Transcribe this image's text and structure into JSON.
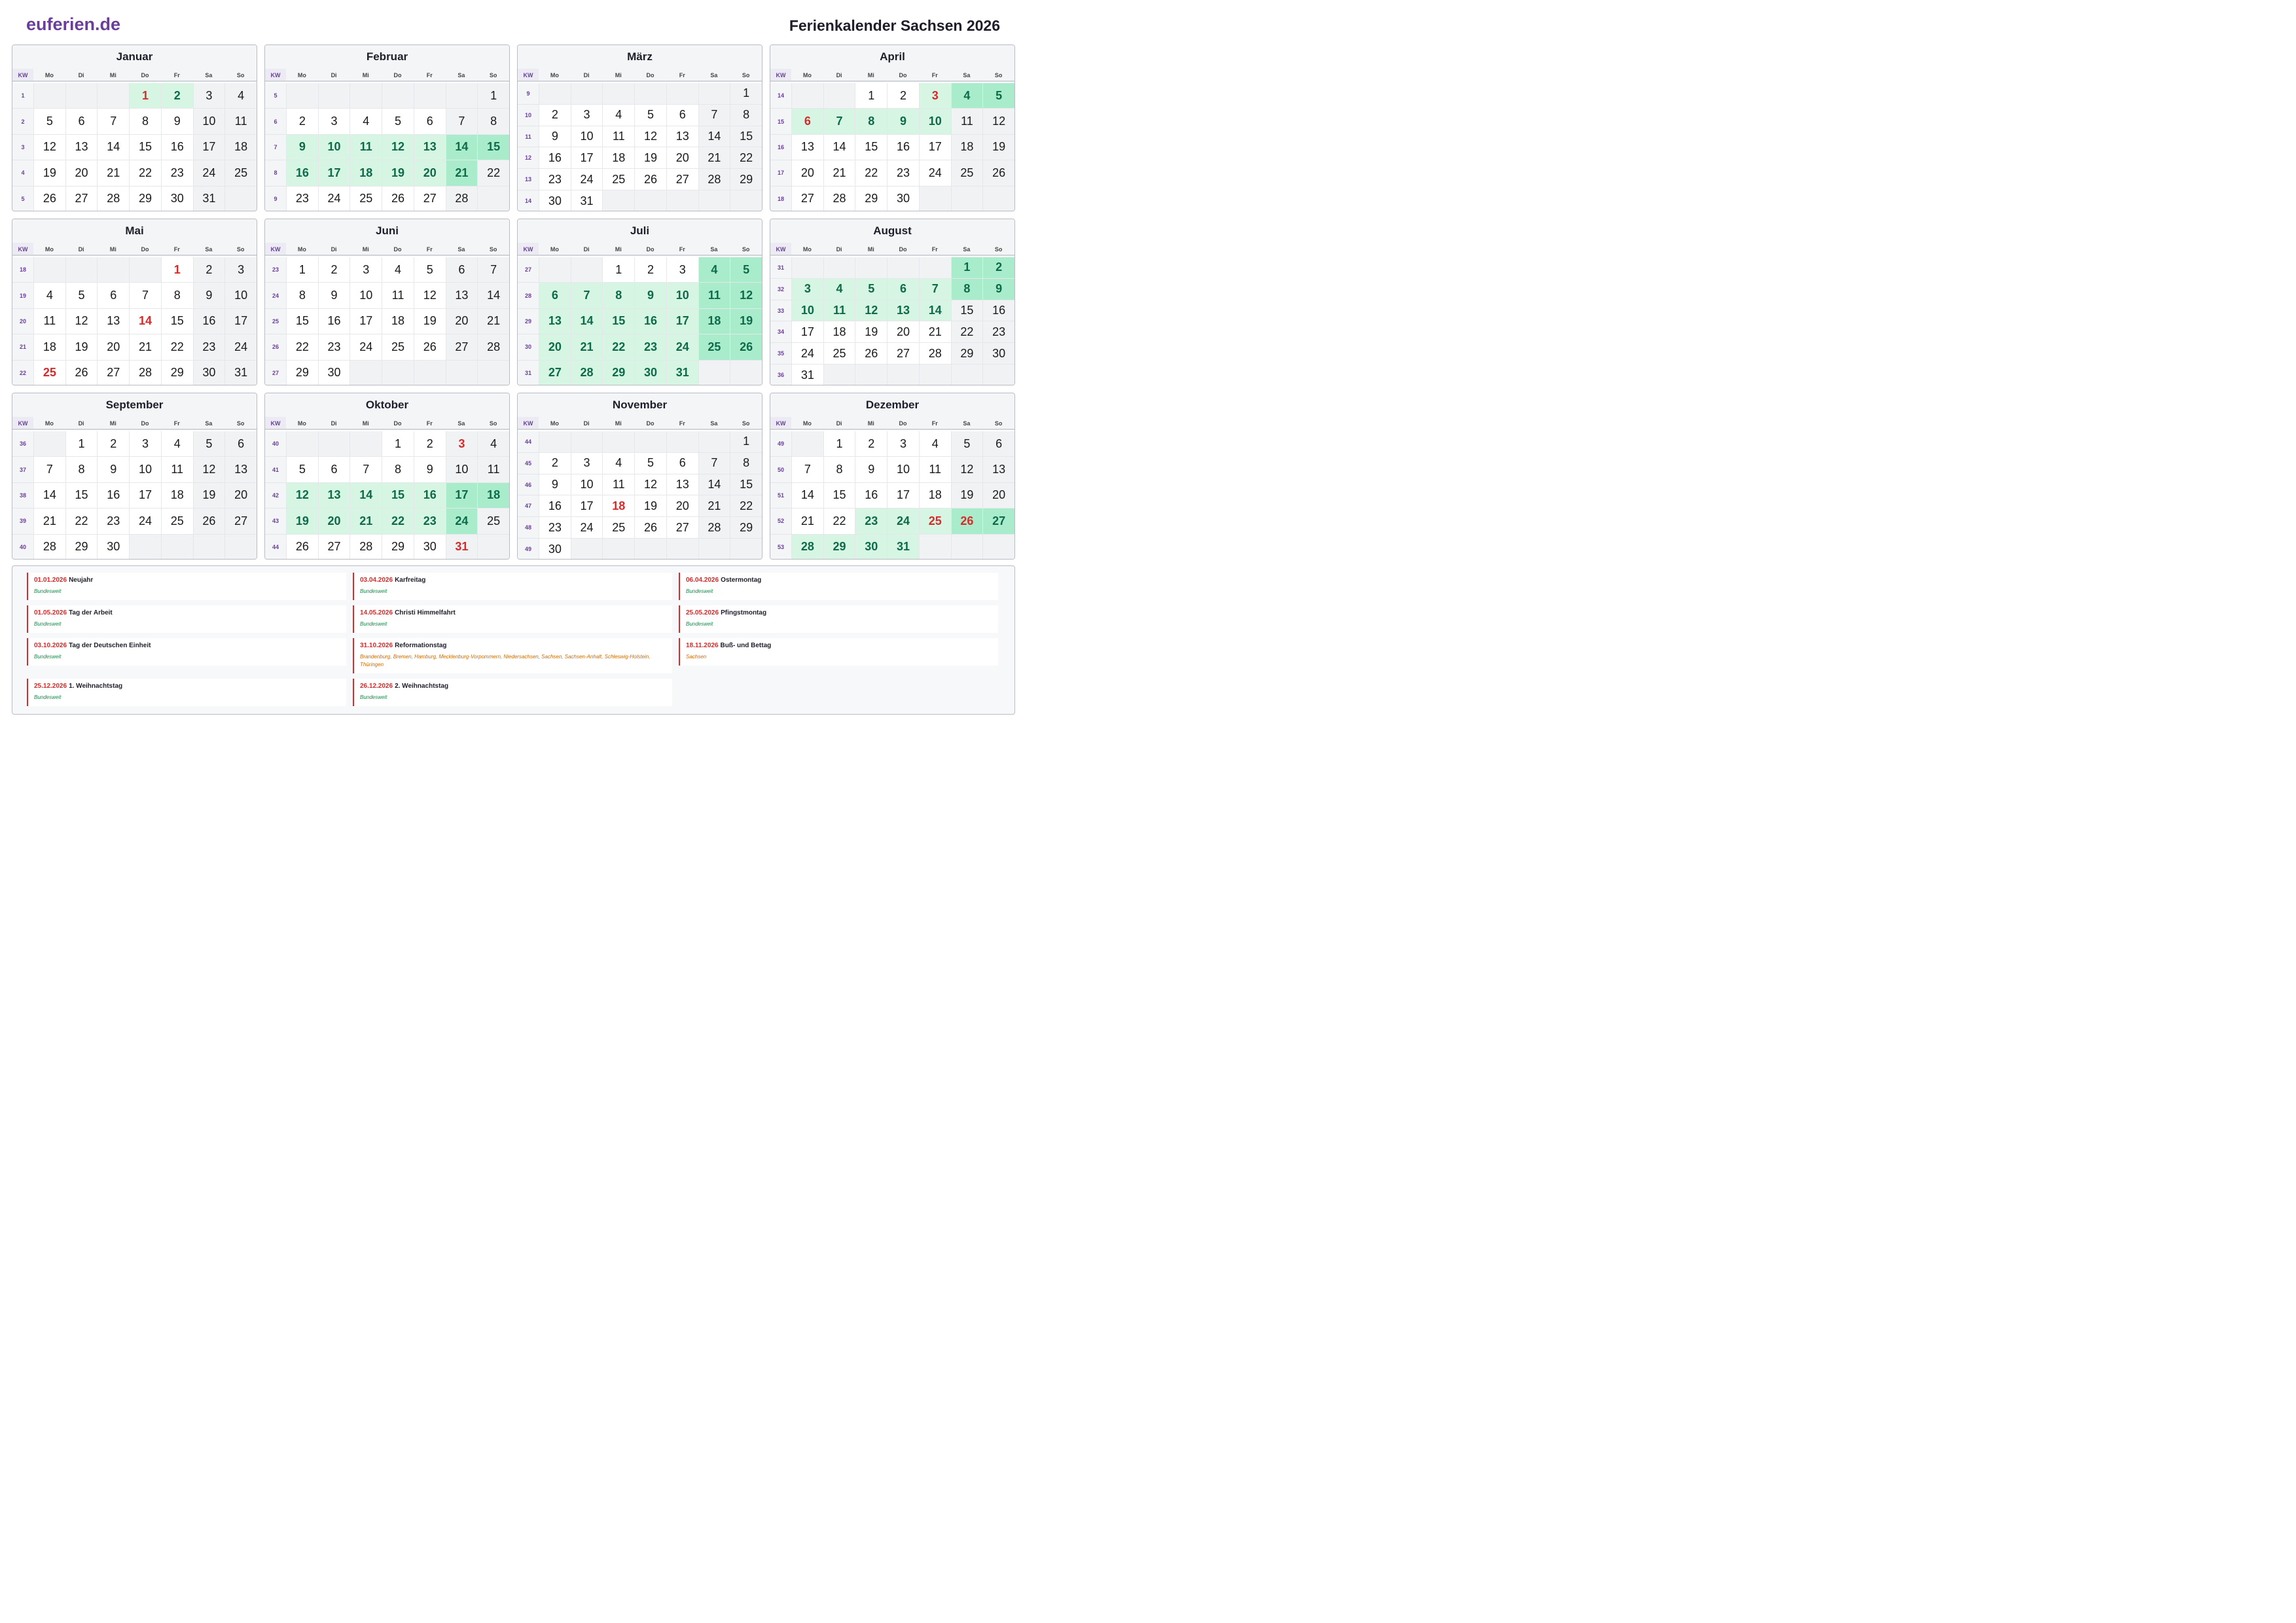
{
  "brand": "euferien.de",
  "title": "Ferienkalender Sachsen 2026",
  "weekday_headers": [
    "Mo",
    "Di",
    "Mi",
    "Do",
    "Fr",
    "Sa",
    "So"
  ],
  "kw_header": "KW",
  "colors": {
    "brand": "#6a3f9a",
    "holiday": "#d52b2b",
    "vacation_bg": "#d6f5e3",
    "vacation_weekend_bg": "#a9eccb",
    "vacation_text": "#0d6b4a",
    "weekend_bg": "#f1f2f4"
  },
  "months": [
    {
      "name": "Januar",
      "start": 3,
      "days": 31,
      "kw": [
        "1",
        "2",
        "3",
        "4",
        "5"
      ],
      "holidays": [
        1
      ],
      "vacation": [
        1,
        2
      ]
    },
    {
      "name": "Februar",
      "start": 6,
      "days": 28,
      "kw": [
        "5",
        "6",
        "7",
        "8",
        "9"
      ],
      "holidays": [],
      "vacation": [
        9,
        10,
        11,
        12,
        13,
        14,
        15,
        16,
        17,
        18,
        19,
        20,
        21
      ]
    },
    {
      "name": "März",
      "start": 6,
      "days": 31,
      "kw": [
        "9",
        "10",
        "11",
        "12",
        "13",
        "14"
      ],
      "holidays": [],
      "vacation": []
    },
    {
      "name": "April",
      "start": 2,
      "days": 30,
      "kw": [
        "14",
        "15",
        "16",
        "17",
        "18"
      ],
      "holidays": [
        3,
        6
      ],
      "vacation": [
        3,
        4,
        5,
        6,
        7,
        8,
        9,
        10
      ]
    },
    {
      "name": "Mai",
      "start": 4,
      "days": 31,
      "kw": [
        "18",
        "19",
        "20",
        "21",
        "22"
      ],
      "holidays": [
        1,
        14,
        25
      ],
      "vacation": []
    },
    {
      "name": "Juni",
      "start": 0,
      "days": 30,
      "kw": [
        "23",
        "24",
        "25",
        "26",
        "27"
      ],
      "holidays": [],
      "vacation": []
    },
    {
      "name": "Juli",
      "start": 2,
      "days": 31,
      "kw": [
        "27",
        "28",
        "29",
        "30",
        "31"
      ],
      "holidays": [],
      "vacation": [
        4,
        5,
        6,
        7,
        8,
        9,
        10,
        11,
        12,
        13,
        14,
        15,
        16,
        17,
        18,
        19,
        20,
        21,
        22,
        23,
        24,
        25,
        26,
        27,
        28,
        29,
        30,
        31
      ]
    },
    {
      "name": "August",
      "start": 5,
      "days": 31,
      "kw": [
        "31",
        "32",
        "33",
        "34",
        "35",
        "36"
      ],
      "holidays": [],
      "vacation": [
        1,
        2,
        3,
        4,
        5,
        6,
        7,
        8,
        9,
        10,
        11,
        12,
        13,
        14
      ]
    },
    {
      "name": "September",
      "start": 1,
      "days": 30,
      "kw": [
        "36",
        "37",
        "38",
        "39",
        "40"
      ],
      "holidays": [],
      "vacation": []
    },
    {
      "name": "Oktober",
      "start": 3,
      "days": 31,
      "kw": [
        "40",
        "41",
        "42",
        "43",
        "44"
      ],
      "holidays": [
        3,
        31
      ],
      "vacation": [
        12,
        13,
        14,
        15,
        16,
        17,
        18,
        19,
        20,
        21,
        22,
        23,
        24
      ]
    },
    {
      "name": "November",
      "start": 6,
      "days": 30,
      "kw": [
        "44",
        "45",
        "46",
        "47",
        "48",
        "49"
      ],
      "holidays": [
        18
      ],
      "vacation": []
    },
    {
      "name": "Dezember",
      "start": 1,
      "days": 31,
      "kw": [
        "49",
        "50",
        "51",
        "52",
        "53"
      ],
      "holidays": [
        25,
        26
      ],
      "vacation": [
        23,
        24,
        25,
        26,
        27,
        28,
        29,
        30,
        31
      ]
    }
  ],
  "holidays": [
    {
      "date": "01.01.2026",
      "name": "Neujahr",
      "region": "Bundesweit"
    },
    {
      "date": "03.04.2026",
      "name": "Karfreitag",
      "region": "Bundesweit"
    },
    {
      "date": "06.04.2026",
      "name": "Ostermontag",
      "region": "Bundesweit"
    },
    {
      "date": "01.05.2026",
      "name": "Tag der Arbeit",
      "region": "Bundesweit"
    },
    {
      "date": "14.05.2026",
      "name": "Christi Himmelfahrt",
      "region": "Bundesweit"
    },
    {
      "date": "25.05.2026",
      "name": "Pfingstmontag",
      "region": "Bundesweit"
    },
    {
      "date": "03.10.2026",
      "name": "Tag der Deutschen Einheit",
      "region": "Bundesweit"
    },
    {
      "date": "31.10.2026",
      "name": "Reformationstag",
      "region": "Brandenburg, Bremen, Hamburg, Mecklenburg-Vorpommern, Niedersachsen, Sachsen, Sachsen-Anhalt, Schleswig-Holstein, Thüringen"
    },
    {
      "date": "18.11.2026",
      "name": "Buß- und Bettag",
      "region": "Sachsen"
    },
    {
      "date": "25.12.2026",
      "name": "1. Weihnachtstag",
      "region": "Bundesweit"
    },
    {
      "date": "26.12.2026",
      "name": "2. Weihnachtstag",
      "region": "Bundesweit"
    }
  ]
}
